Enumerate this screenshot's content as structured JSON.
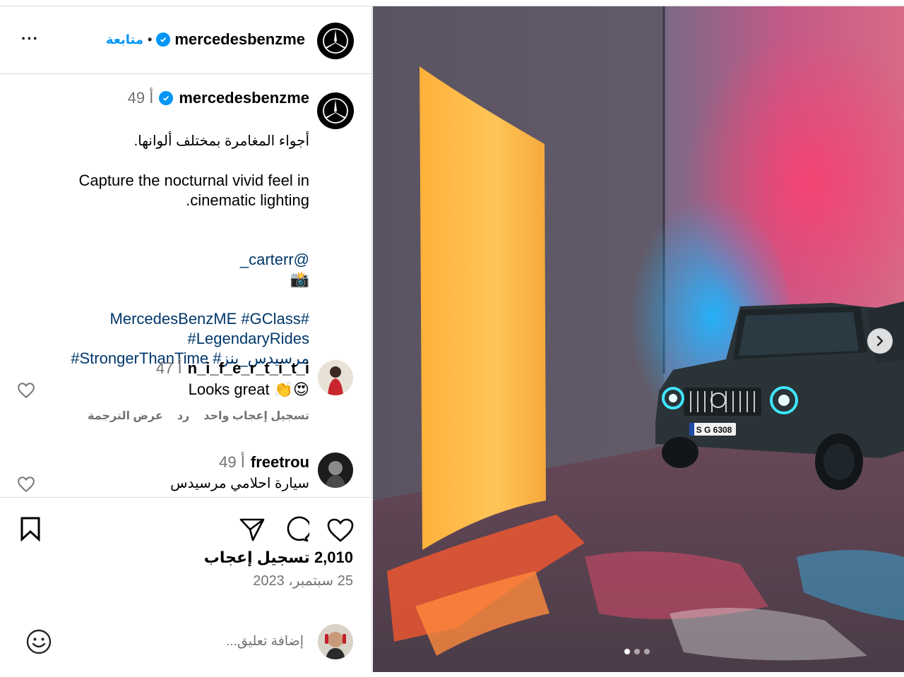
{
  "post": {
    "username": "mercedesbenzme",
    "follow_label": "متابعة",
    "separator": "•"
  },
  "caption": {
    "username": "mercedesbenzme",
    "time": "49 أ",
    "arabic_line": "أجواء المغامرة بمختلف ألوانها.",
    "english_line": "Capture the nocturnal vivid feel in\n.cinematic lighting",
    "credit_emoji": "📸",
    "credit_handle": "_carterr@",
    "hashtags_line1": "MercedesBenzME #GClass#",
    "hashtags_line2": "#LegendaryRides",
    "hashtags_line3": "#StrongerThanTime #مرسيدس_بنز"
  },
  "comments": [
    {
      "username": "n_i_f_e_r_t_i_t_i",
      "time": "47 أ",
      "text": "Looks great 👏😍",
      "likes_label": "تسجيل إعجاب واحد",
      "reply_label": "رد",
      "translate_label": "عرض الترجمة"
    },
    {
      "username": "freetrou",
      "time": "49 أ",
      "text": "سيارة احلامي مرسيدس"
    }
  ],
  "footer": {
    "likes": "2,010 تسجيل إعجاب",
    "date": "25 سبتمبر، 2023",
    "comment_placeholder": "إضافة تعليق..."
  },
  "image": {
    "plate_text": "S G 6308",
    "carousel_count": 3,
    "carousel_active": 1
  },
  "colors": {
    "accent": "#0095f6",
    "hashtag": "#00376b",
    "muted": "#737373",
    "border": "#dbdbdb"
  },
  "icons": [
    "more-icon",
    "verified-icon",
    "mercedes-logo-icon",
    "heart-icon",
    "comment-icon",
    "share-icon",
    "bookmark-icon",
    "emoji-icon",
    "chevron-right-icon"
  ]
}
